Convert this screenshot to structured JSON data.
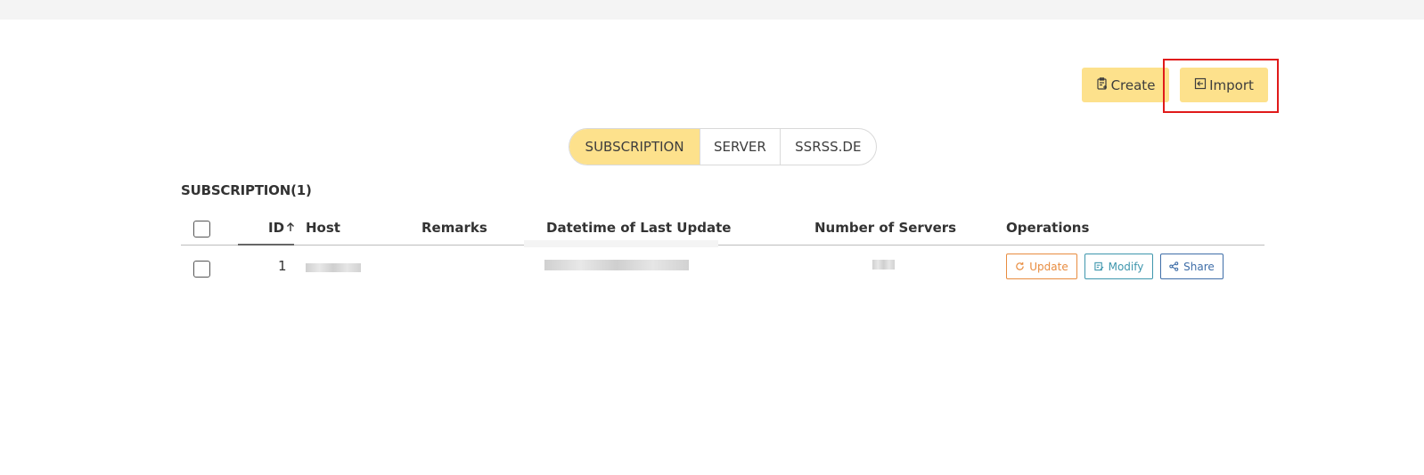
{
  "toolbar": {
    "create_label": "Create",
    "import_label": "Import"
  },
  "tabs": [
    {
      "label": "SUBSCRIPTION",
      "active": true
    },
    {
      "label": "SERVER",
      "active": false
    },
    {
      "label": "SSRSS.DE",
      "active": false
    }
  ],
  "section": {
    "title": "SUBSCRIPTION(1)"
  },
  "table": {
    "headers": {
      "id": "ID",
      "host": "Host",
      "remarks": "Remarks",
      "datetime": "Datetime of Last Update",
      "servers": "Number of Servers",
      "operations": "Operations"
    },
    "rows": [
      {
        "id": "1",
        "remarks": ""
      }
    ],
    "operations": {
      "update": "Update",
      "modify": "Modify",
      "share": "Share"
    }
  },
  "colors": {
    "accent": "#fde18c",
    "highlight": "#e01a1a",
    "update": "#e88c3f",
    "modify": "#3e96ad",
    "share": "#3f6ea8"
  },
  "icons": [
    "create-icon",
    "import-icon",
    "sort-asc-icon",
    "refresh-icon",
    "edit-icon",
    "share-icon"
  ]
}
